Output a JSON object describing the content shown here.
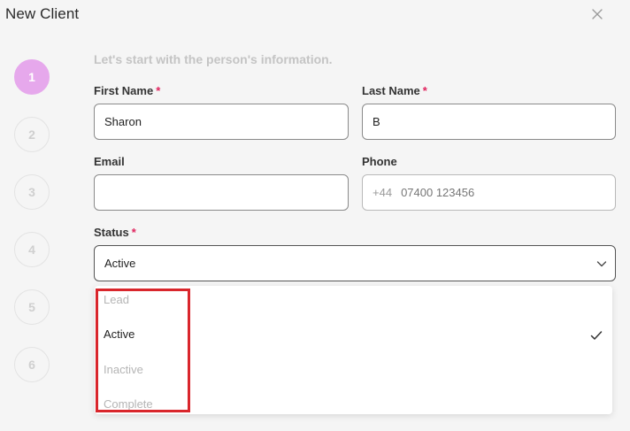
{
  "dialog": {
    "title": "New Client"
  },
  "steps": [
    "1",
    "2",
    "3",
    "4",
    "5",
    "6"
  ],
  "intro": "Let's start with the person's information.",
  "fields": {
    "first_name": {
      "label": "First Name",
      "required_mark": "*",
      "value": "Sharon"
    },
    "last_name": {
      "label": "Last Name",
      "required_mark": "*",
      "value": "B"
    },
    "email": {
      "label": "Email",
      "value": ""
    },
    "phone": {
      "label": "Phone",
      "prefix": "+44",
      "placeholder": "07400 123456"
    },
    "status": {
      "label": "Status",
      "required_mark": "*",
      "value": "Active"
    }
  },
  "status_options": [
    {
      "label": "Lead",
      "selected": false
    },
    {
      "label": "Active",
      "selected": true
    },
    {
      "label": "Inactive",
      "selected": false
    },
    {
      "label": "Complete",
      "selected": false
    }
  ],
  "colors": {
    "active_step": "#e6a8ec",
    "required": "#e0245e",
    "highlight_box": "#d9262c"
  }
}
